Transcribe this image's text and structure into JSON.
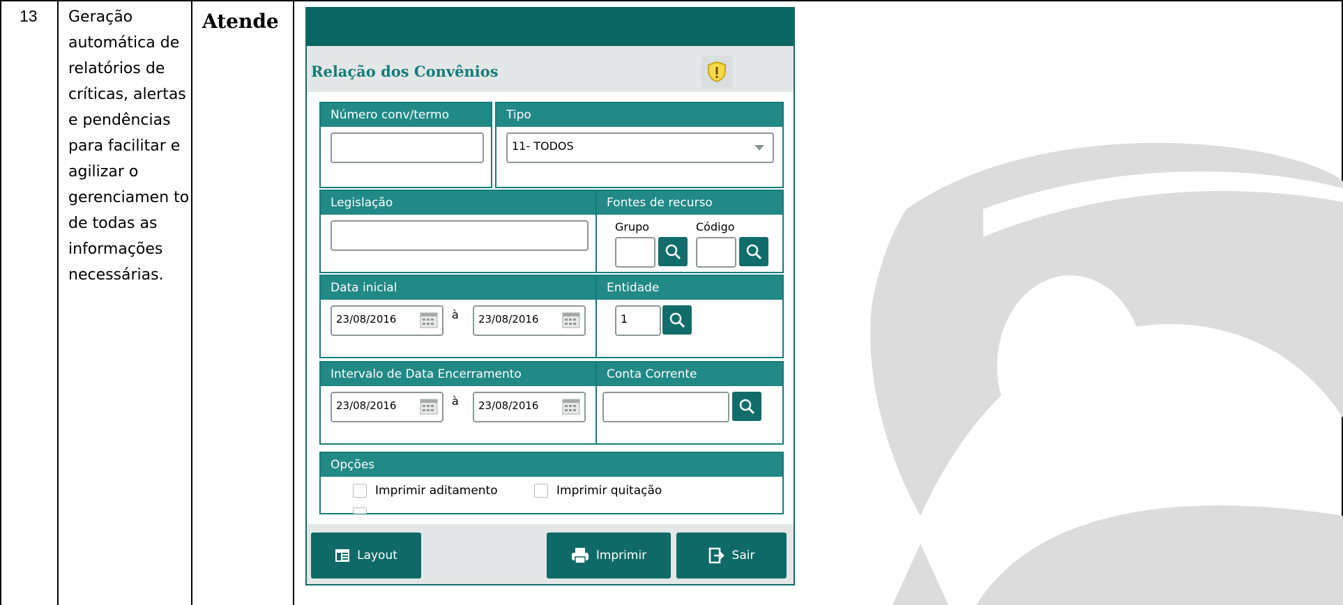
{
  "row": {
    "number": "13",
    "requirement": "Geração automática de relatórios de críticas, alertas e pendências para facilitar e agilizar o gerenciamen to de todas as informações necessárias.",
    "status": "Atende"
  },
  "window": {
    "title": "Relação dos Convênios",
    "accent": "#0a6562",
    "warn_icon": "warning-shield-icon"
  },
  "numero": {
    "label": "Número conv/termo",
    "value": ""
  },
  "tipo": {
    "label": "Tipo",
    "value": "11- TODOS"
  },
  "legislacao": {
    "label": "Legislação",
    "value": ""
  },
  "fontes": {
    "label": "Fontes de recurso",
    "grupo_label": "Grupo",
    "codigo_label": "Código",
    "grupo_value": "",
    "codigo_value": ""
  },
  "data_inicial": {
    "label": "Data inicial",
    "from": "23/08/2016",
    "sep": "à",
    "to": "23/08/2016"
  },
  "entidade": {
    "label": "Entidade",
    "value": "1"
  },
  "encerramento": {
    "label": "Intervalo de Data Encerramento",
    "from": "23/08/2016",
    "sep": "à",
    "to": "23/08/2016"
  },
  "conta": {
    "label": "Conta Corrente",
    "value": ""
  },
  "opcoes": {
    "label": "Opções",
    "items": [
      {
        "label": "Imprimir aditamento",
        "checked": false
      },
      {
        "label": "Imprimir quitação",
        "checked": false
      }
    ]
  },
  "buttons": {
    "layout": "Layout",
    "imprimir": "Imprimir",
    "sair": "Sair"
  }
}
